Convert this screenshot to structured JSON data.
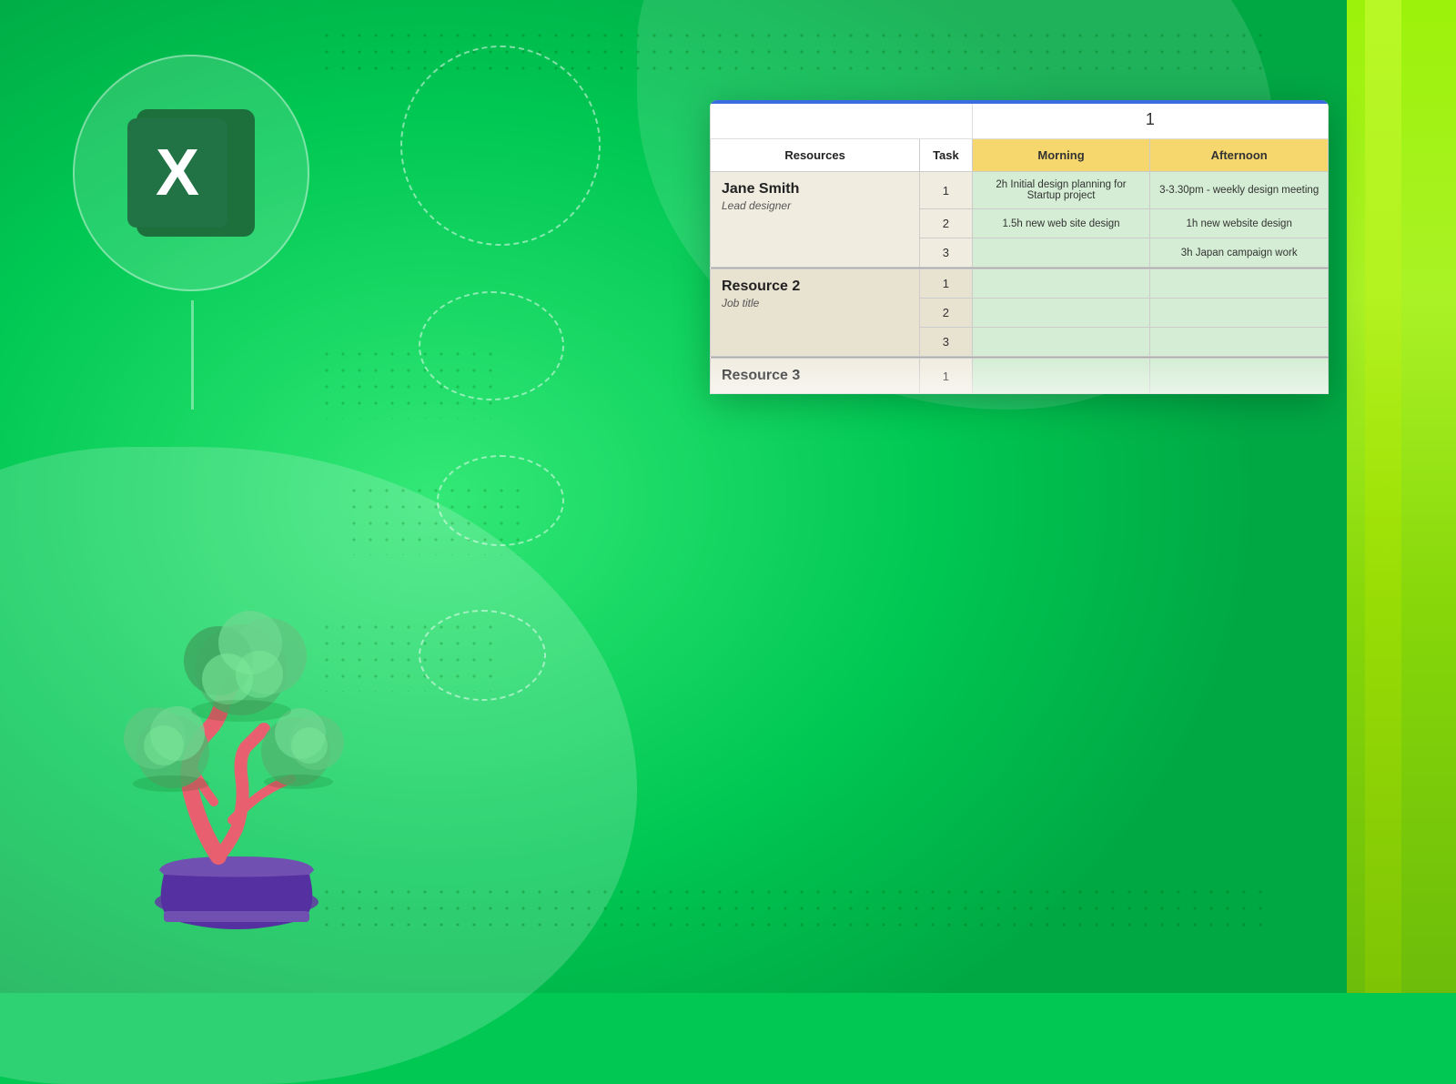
{
  "background": {
    "color": "#00c853"
  },
  "excel_icon": {
    "letter": "X"
  },
  "spreadsheet": {
    "day_number": "1",
    "blue_bar_color": "#3b6be0",
    "morning_header": "Morning",
    "afternoon_header": "Afternoon",
    "morning_bg": "#f5d76e",
    "afternoon_bg": "#f5d76e",
    "headers": {
      "resources": "Resources",
      "task": "Task"
    },
    "resources": [
      {
        "name": "Jane Smith",
        "title": "Lead designer",
        "tasks": [
          {
            "num": "1",
            "morning": "2h Initial design planning for Startup project",
            "afternoon": "3-3.30pm - weekly design meeting"
          },
          {
            "num": "2",
            "morning": "1.5h new web site design",
            "afternoon": "1h new website design"
          },
          {
            "num": "3",
            "morning": "",
            "afternoon": "3h Japan campaign work"
          }
        ]
      },
      {
        "name": "Resource 2",
        "title": "Job title",
        "tasks": [
          {
            "num": "1",
            "morning": "",
            "afternoon": ""
          },
          {
            "num": "2",
            "morning": "",
            "afternoon": ""
          },
          {
            "num": "3",
            "morning": "",
            "afternoon": ""
          }
        ]
      },
      {
        "name": "Resource 3",
        "title": "",
        "tasks": [
          {
            "num": "1",
            "morning": "",
            "afternoon": ""
          }
        ]
      }
    ]
  }
}
